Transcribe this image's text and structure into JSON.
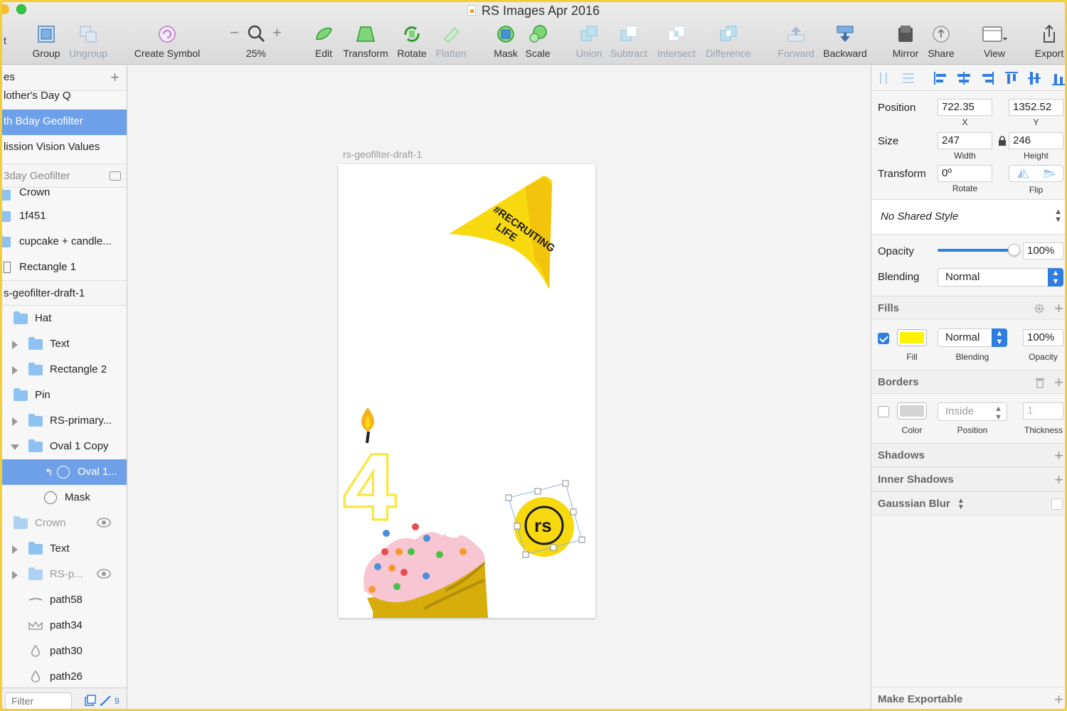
{
  "window": {
    "title": "RS Images Apr 2016",
    "left_edge_char": "t"
  },
  "toolbar": {
    "group": "Group",
    "ungroup": "Ungroup",
    "create_symbol": "Create Symbol",
    "zoom_level": "25%",
    "edit": "Edit",
    "transform": "Transform",
    "rotate": "Rotate",
    "flatten": "Flatten",
    "mask": "Mask",
    "scale": "Scale",
    "union": "Union",
    "subtract": "Subtract",
    "intersect": "Intersect",
    "difference": "Difference",
    "forward": "Forward",
    "backward": "Backward",
    "mirror": "Mirror",
    "share": "Share",
    "view": "View",
    "export": "Export"
  },
  "pages": {
    "header": "es",
    "items": [
      {
        "label": "lother's Day Q"
      },
      {
        "label": "th Bday Geofilter"
      },
      {
        "label": "lission Vision Values"
      }
    ]
  },
  "layers": {
    "artboard_group": "3day Geofilter",
    "items": [
      {
        "label": "Crown"
      },
      {
        "label": "1f451"
      },
      {
        "label": "cupcake + candle..."
      },
      {
        "label": "Rectangle 1"
      },
      {
        "label": "s-geofilter-draft-1"
      },
      {
        "label": "Hat"
      },
      {
        "label": "Text"
      },
      {
        "label": "Rectangle 2"
      },
      {
        "label": "Pin"
      },
      {
        "label": "RS-primary..."
      },
      {
        "label": "Oval 1 Copy"
      },
      {
        "label": "Oval 1..."
      },
      {
        "label": "Mask"
      },
      {
        "label": "Crown"
      },
      {
        "label": "Text"
      },
      {
        "label": "RS-p..."
      },
      {
        "label": "path58"
      },
      {
        "label": "path34"
      },
      {
        "label": "path30"
      },
      {
        "label": "path26"
      }
    ],
    "filter_placeholder": "Filter",
    "filter_count": "9"
  },
  "canvas": {
    "artboard_name": "rs-geofilter-draft-1",
    "hat_text_line1": "#RECRUITING",
    "hat_text_line2": "LIFE",
    "candle_digit": "4",
    "badge_text": "rs",
    "colors": {
      "brand_yellow": "#f8d90f",
      "frosting_pink": "#f7c6d2",
      "cup_gold": "#d7ad0c"
    }
  },
  "inspector": {
    "position_label": "Position",
    "position_x": "722.35",
    "position_y": "1352.52",
    "x_label": "X",
    "y_label": "Y",
    "size_label": "Size",
    "width": "247",
    "height": "246",
    "width_label": "Width",
    "height_label": "Height",
    "transform_label": "Transform",
    "rotate_value": "0º",
    "rotate_label": "Rotate",
    "flip_label": "Flip",
    "shared_style": "No Shared Style",
    "opacity_label": "Opacity",
    "opacity_value": "100%",
    "opacity_fraction": 1.0,
    "blending_label": "Blending",
    "blending_value": "Normal",
    "fills": {
      "title": "Fills",
      "enabled": true,
      "color": "#fff200",
      "blending": "Normal",
      "opacity": "100%",
      "fill_label": "Fill",
      "blending_label": "Blending",
      "opacity_label": "Opacity"
    },
    "borders": {
      "title": "Borders",
      "enabled": false,
      "color": "#d4d4d4",
      "position": "Inside",
      "thickness": "1",
      "color_label": "Color",
      "position_label": "Position",
      "thickness_label": "Thickness"
    },
    "shadows": "Shadows",
    "inner_shadows": "Inner Shadows",
    "gaussian_blur": "Gaussian Blur",
    "make_exportable": "Make Exportable"
  }
}
